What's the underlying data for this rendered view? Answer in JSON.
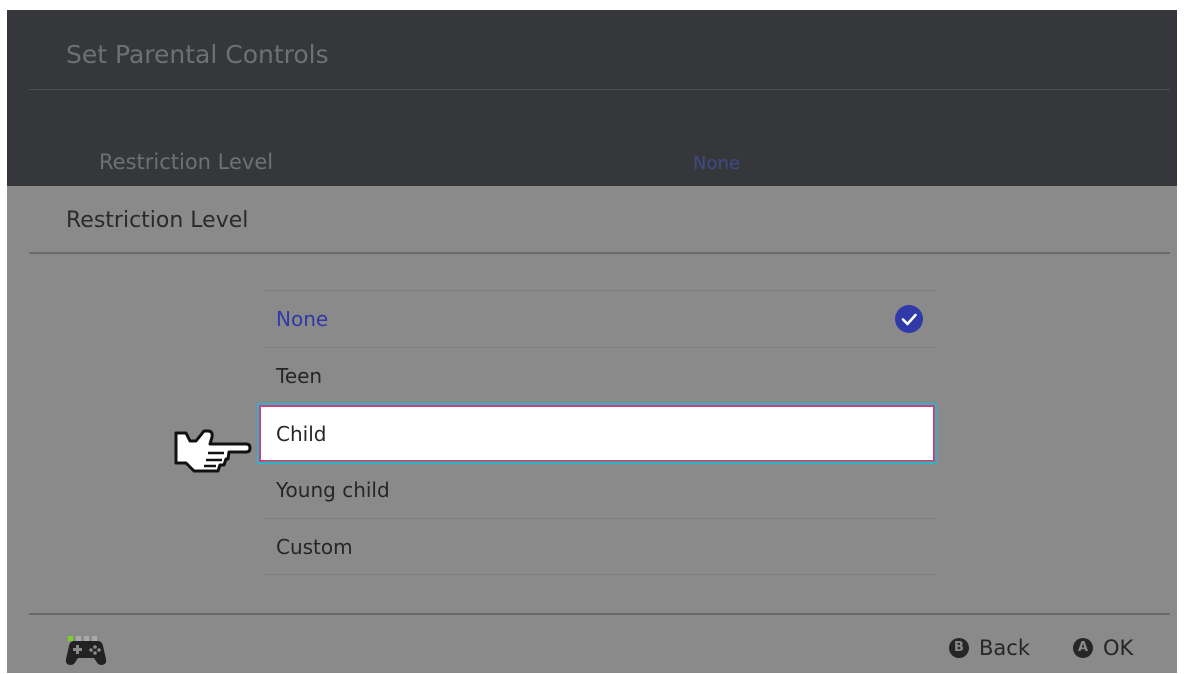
{
  "background_page": {
    "title": "Set Parental Controls",
    "row_label": "Restriction Level",
    "row_value": "None"
  },
  "popup": {
    "title": "Restriction Level",
    "options": [
      {
        "label": "None",
        "selected": true
      },
      {
        "label": "Teen",
        "selected": false
      },
      {
        "label": "Child",
        "selected": false,
        "focused": true
      },
      {
        "label": "Young child",
        "selected": false
      },
      {
        "label": "Custom",
        "selected": false
      }
    ]
  },
  "footer": {
    "back_button_glyph": "B",
    "back_label": "Back",
    "ok_button_glyph": "A",
    "ok_label": "OK",
    "controller_icon": "gamepad-icon"
  },
  "colors": {
    "accent_blue": "#2f3aa8",
    "focus_border": "#d23d7a",
    "focus_glow": "#2fb3c8"
  }
}
